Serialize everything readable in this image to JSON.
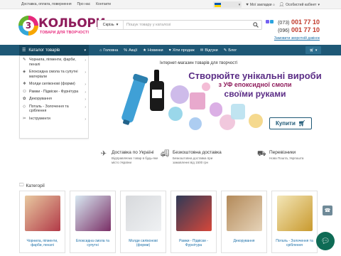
{
  "topbar": {
    "links": [
      "Доставка, оплата, повернення",
      "Про нас",
      "Контакти"
    ],
    "wishlist_label": "Мої закладки",
    "wishlist_count": "0",
    "account_label": "Особистий кабінет",
    "lang_flag_colors": [
      "#0057b7",
      "#ffd700"
    ]
  },
  "logo": {
    "mark": "3",
    "title": "КОЛЬОРИ",
    "subtitle": "ТОВАРИ ДЛЯ ТВОРЧОСТІ"
  },
  "search": {
    "category": "Скрізь",
    "placeholder": "Пошук товару у каталозі"
  },
  "contacts": {
    "phone1_prefix": "(073)",
    "phone1_number": "001 77 10",
    "phone2_prefix": "(096)",
    "phone2_number": "001 77 10",
    "callback": "Замовити зворотній дзвінок"
  },
  "nav": {
    "catalog_label": "Каталог товарів",
    "items": [
      {
        "icon": "home-icon",
        "label": "Головна"
      },
      {
        "icon": "percent-icon",
        "label": "Акції"
      },
      {
        "icon": "new-icon",
        "label": "Новинки"
      },
      {
        "icon": "heart-icon",
        "label": "Хіти продаж"
      },
      {
        "icon": "comments-icon",
        "label": "Відгуки"
      },
      {
        "icon": "blog-icon",
        "label": "Блог"
      }
    ]
  },
  "catalog_menu": [
    {
      "label": "Чорнила, пігменти, фарби, пензлі"
    },
    {
      "label": "Епоксидна смола та супутні матеріали"
    },
    {
      "label": "Молди силіконові (форми)"
    },
    {
      "label": "Рамки - Підвіски - Фурнітура"
    },
    {
      "label": "Декорування"
    },
    {
      "label": "Поталь - Золочення та сріблення"
    },
    {
      "label": "Інструменти"
    }
  ],
  "hero": {
    "top_text": "Інтернет-магазин товарів для творчості",
    "line1": "Створюйте унікальні вироби",
    "line2": "з УФ епоксидної смоли",
    "line3": "своїми руками",
    "buy_label": "Купити"
  },
  "features": [
    {
      "icon": "plane-icon",
      "title": "Доставка по Україні",
      "desc": "Відправляємо товар в будь-яке місто України"
    },
    {
      "icon": "truck-icon",
      "title": "Безкоштовна доставка",
      "desc": "Безкоштовна доставка при замовленні від 1500 грн"
    },
    {
      "icon": "delivery-icon",
      "title": "Перевізники",
      "desc": "Нова Пошта, Укрпошта"
    }
  ],
  "categories": {
    "title": "Категорії",
    "items": [
      {
        "name": "Чорнила, пігменти, фарби, пензлі",
        "color1": "#e8c9a0",
        "color2": "#b23a48"
      },
      {
        "name": "Епоксидна смола та супутні",
        "color1": "#d8e9f2",
        "color2": "#7a2f66"
      },
      {
        "name": "Молди силіконові (форми)",
        "color1": "#d7d9dc",
        "color2": "#eff1f3"
      },
      {
        "name": "Рамки - Підвіски - Фурнітура",
        "color1": "#2f3a57",
        "color2": "#d6473a"
      },
      {
        "name": "Декорування",
        "color1": "#b38a5a",
        "color2": "#e6d3b8"
      },
      {
        "name": "Поталь - Золочення та сріблення",
        "color1": "#f3e6b8",
        "color2": "#c99a2e"
      }
    ]
  }
}
